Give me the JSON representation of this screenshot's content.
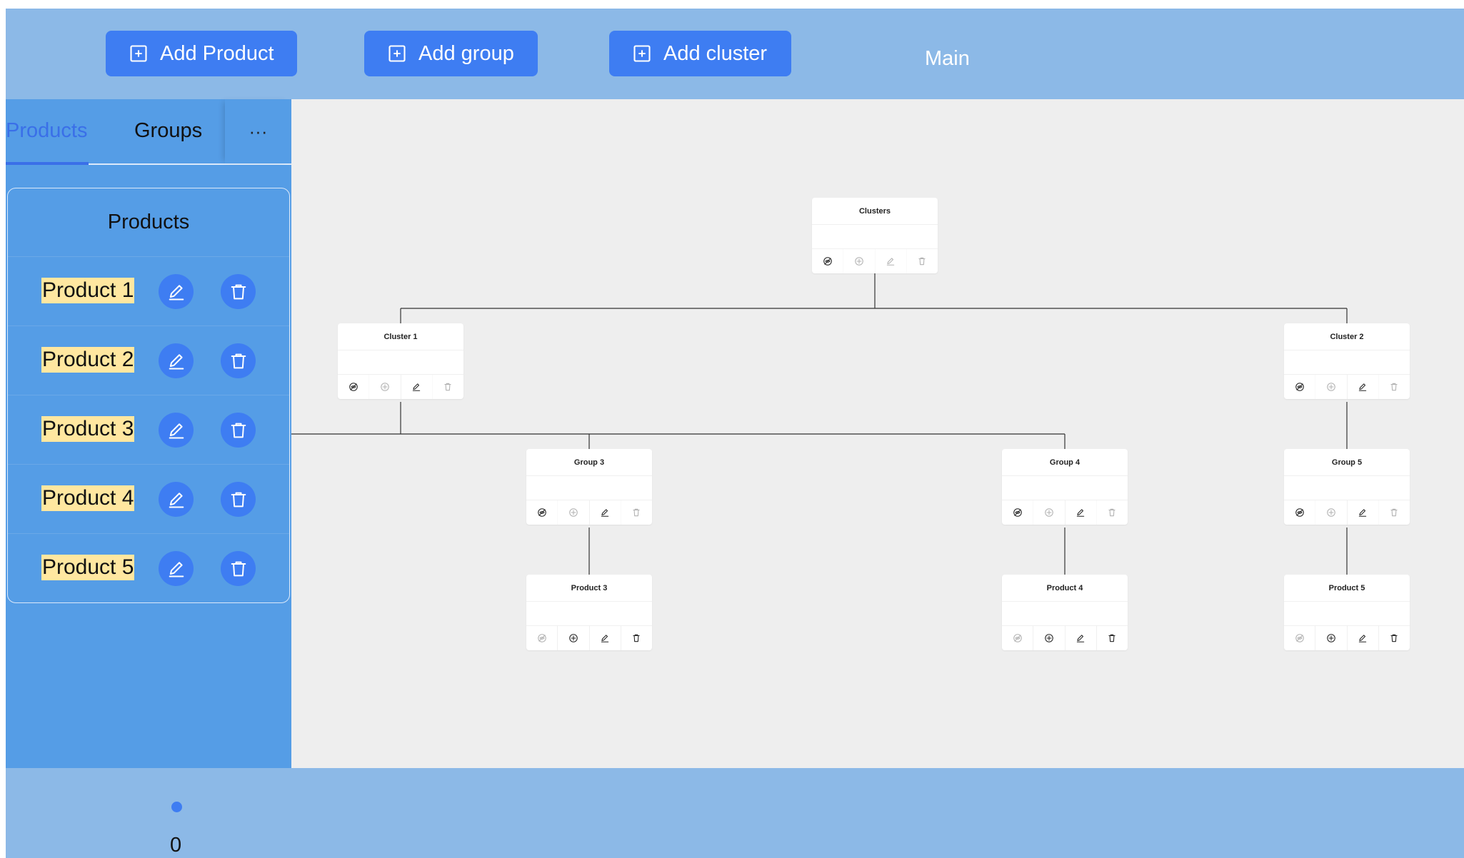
{
  "header": {
    "buttons": {
      "add_product": "Add Product",
      "add_group": "Add group",
      "add_cluster": "Add cluster"
    },
    "main_label": "Main"
  },
  "sidebar": {
    "tabs": {
      "products": "Products",
      "groups": "Groups",
      "more": "···"
    },
    "panel_title": "Products",
    "products": [
      {
        "name": "Product 1"
      },
      {
        "name": "Product 2"
      },
      {
        "name": "Product 3"
      },
      {
        "name": "Product 4"
      },
      {
        "name": "Product 5"
      }
    ]
  },
  "tree": {
    "clusters": {
      "title": "Clusters",
      "actions": [
        "eye-slash-icon",
        "plus-icon",
        "pencil-icon",
        "trash-icon"
      ],
      "disabled": [
        false,
        true,
        true,
        true
      ]
    },
    "cluster_1": {
      "title": "Cluster 1",
      "actions": [
        "eye-slash-icon",
        "plus-icon",
        "pencil-icon",
        "trash-icon"
      ],
      "disabled": [
        false,
        true,
        false,
        true
      ]
    },
    "cluster_2": {
      "title": "Cluster 2",
      "actions": [
        "eye-slash-icon",
        "plus-icon",
        "pencil-icon",
        "trash-icon"
      ],
      "disabled": [
        false,
        true,
        false,
        true
      ]
    },
    "group_3": {
      "title": "Group 3",
      "actions": [
        "eye-slash-icon",
        "plus-icon",
        "pencil-icon",
        "trash-icon"
      ],
      "disabled": [
        false,
        true,
        false,
        true
      ]
    },
    "group_4": {
      "title": "Group 4",
      "actions": [
        "eye-slash-icon",
        "plus-icon",
        "pencil-icon",
        "trash-icon"
      ],
      "disabled": [
        false,
        true,
        false,
        true
      ]
    },
    "group_5": {
      "title": "Group 5",
      "actions": [
        "eye-slash-icon",
        "plus-icon",
        "pencil-icon",
        "trash-icon"
      ],
      "disabled": [
        false,
        true,
        false,
        true
      ]
    },
    "product_3": {
      "title": "Product 3",
      "actions": [
        "eye-slash-icon",
        "plus-icon",
        "pencil-icon",
        "trash-icon"
      ],
      "disabled": [
        true,
        false,
        false,
        false
      ]
    },
    "product_4": {
      "title": "Product 4",
      "actions": [
        "eye-slash-icon",
        "plus-icon",
        "pencil-icon",
        "trash-icon"
      ],
      "disabled": [
        true,
        false,
        false,
        false
      ]
    },
    "product_5": {
      "title": "Product 5",
      "actions": [
        "eye-slash-icon",
        "plus-icon",
        "pencil-icon",
        "trash-icon"
      ],
      "disabled": [
        true,
        false,
        false,
        false
      ]
    }
  },
  "footer": {
    "count": "0"
  },
  "colors": {
    "accent": "#3e7df2",
    "header_bg": "#8cb9e7",
    "sidebar_bg": "#559de6",
    "canvas_bg": "#eeeeee",
    "highlight": "#ffe7a0"
  }
}
